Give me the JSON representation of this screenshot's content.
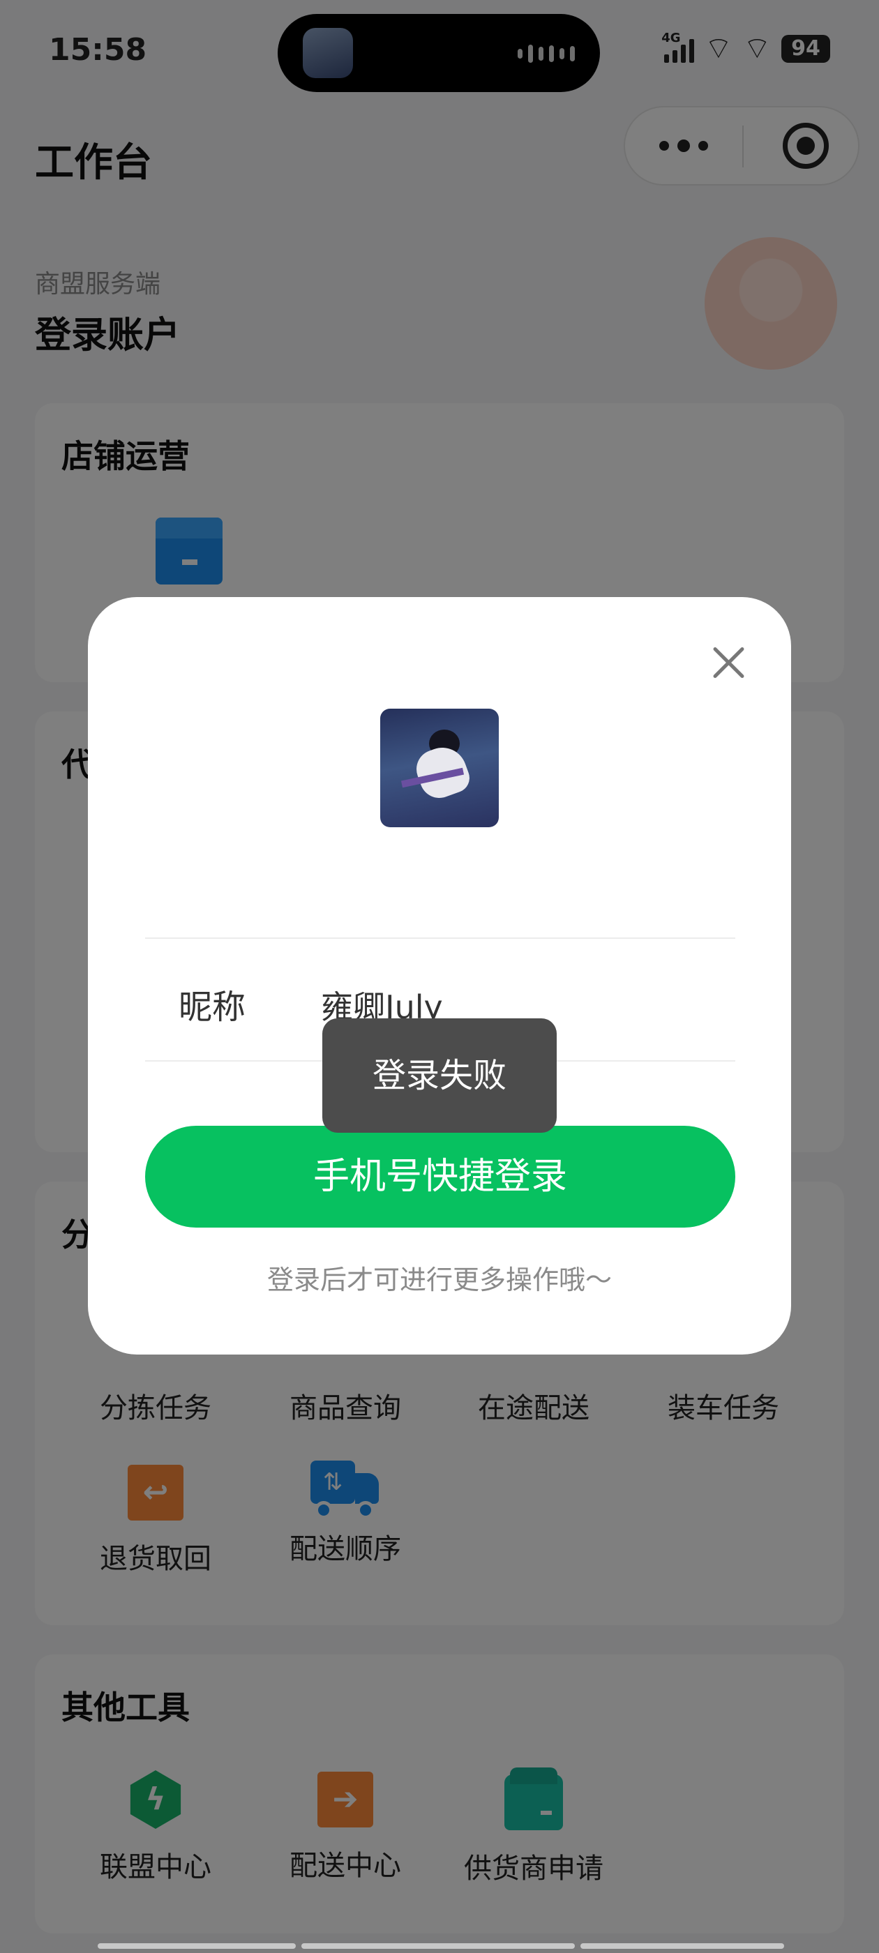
{
  "status_bar": {
    "time": "15:58",
    "network": "4G",
    "battery": "94"
  },
  "header": {
    "title": "工作台"
  },
  "account": {
    "subtitle": "商盟服务端",
    "title": "登录账户"
  },
  "sections": {
    "store": {
      "title": "店铺运营"
    },
    "proxy": {
      "title_stub": "代"
    },
    "sorting": {
      "title_stub": "分",
      "tiles": [
        "分拣任务",
        "商品查询",
        "在途配送",
        "装车任务",
        "退货取回",
        "配送顺序"
      ]
    },
    "tools": {
      "title": "其他工具",
      "tiles": [
        "联盟中心",
        "配送中心",
        "供货商申请"
      ]
    }
  },
  "modal": {
    "nickname_label": "昵称",
    "nickname_value": "雍卿July",
    "login_button": "手机号快捷登录",
    "hint": "登录后才可进行更多操作哦～"
  },
  "toast": {
    "message": "登录失败"
  },
  "colors": {
    "primary_green": "#07c160",
    "toast_bg": "#4c4c4c",
    "icon_blue": "#1d8ff0",
    "icon_orange": "#ff8a3a"
  }
}
